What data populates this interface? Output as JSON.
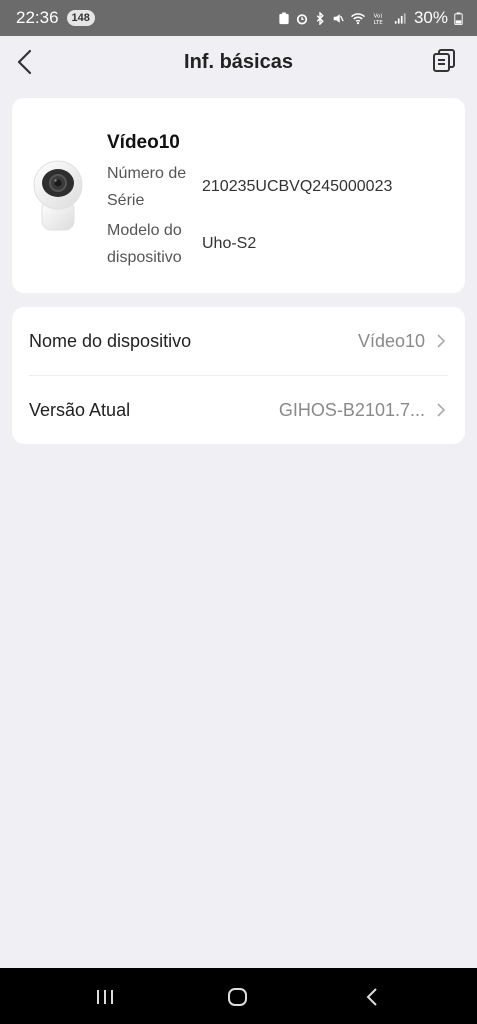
{
  "status_bar": {
    "time": "22:36",
    "badge": "148",
    "battery": "30%",
    "icons": [
      "battery-saver-icon",
      "alarm-icon",
      "bluetooth-icon",
      "mute-icon",
      "wifi-icon",
      "volte-icon",
      "signal-icon",
      "battery-icon"
    ]
  },
  "header": {
    "title": "Inf. básicas",
    "back_icon": "back-arrow-icon",
    "copy_icon": "copy-icon"
  },
  "device": {
    "name": "Vídeo10",
    "serial_label": "Número de Série",
    "serial_value": "210235UCBVQ245000023",
    "model_label": "Modelo do dispositivo",
    "model_value": "Uho-S2",
    "image_icon": "camera-icon"
  },
  "settings": [
    {
      "label": "Nome do dispositivo",
      "value": "Vídeo10"
    },
    {
      "label": "Versão Atual",
      "value": "GIHOS-B2101.7..."
    }
  ],
  "nav": {
    "icons": [
      "recents-icon",
      "home-icon",
      "back-icon"
    ]
  },
  "colors": {
    "background": "#f0eff4",
    "card": "#ffffff",
    "status_bar": "#6b6b6b",
    "nav_bar": "#000000"
  }
}
